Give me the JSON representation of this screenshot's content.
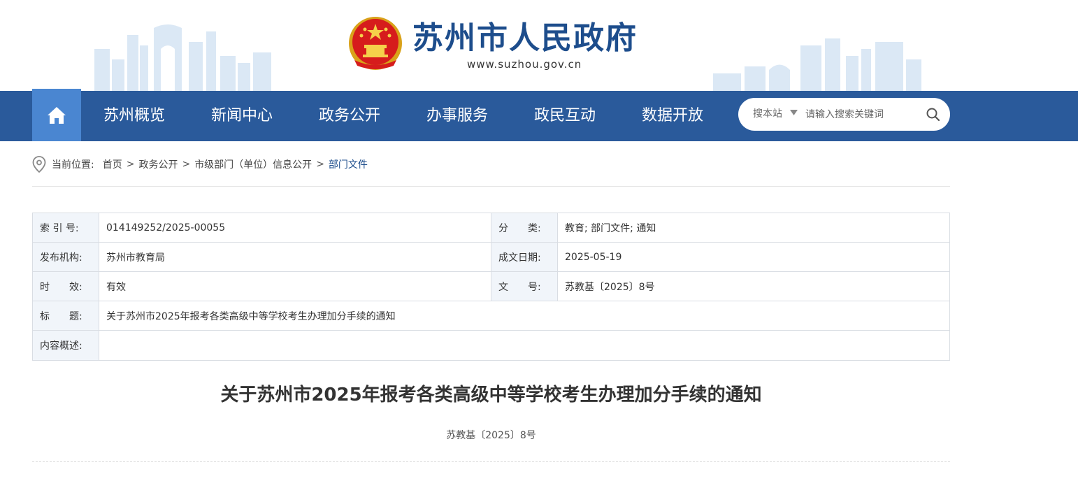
{
  "header": {
    "site_title": "苏州市人民政府",
    "site_url": "www.suzhou.gov.cn"
  },
  "nav": {
    "items": [
      "苏州概览",
      "新闻中心",
      "政务公开",
      "办事服务",
      "政民互动",
      "数据开放"
    ]
  },
  "search": {
    "scope": "搜本站",
    "placeholder": "请输入搜索关键词"
  },
  "breadcrumb": {
    "label": "当前位置:",
    "items": [
      "首页",
      "政务公开",
      "市级部门（单位）信息公开",
      "部门文件"
    ],
    "separator": ">"
  },
  "info_table": {
    "index_label": "索 引 号:",
    "index_value": "014149252/2025-00055",
    "category_label": "分　　类:",
    "category_value": "教育;  部门文件;  通知",
    "publisher_label": "发布机构:",
    "publisher_value": "苏州市教育局",
    "date_label": "成文日期:",
    "date_value": "2025-05-19",
    "validity_label": "时　　效:",
    "validity_value": "有效",
    "docno_label": "文　　号:",
    "docno_value": "苏教基〔2025〕8号",
    "title_label": "标　　题:",
    "title_value": "关于苏州市2025年报考各类高级中等学校考生办理加分手续的通知",
    "summary_label": "内容概述:",
    "summary_value": ""
  },
  "article": {
    "title": "关于苏州市2025年报考各类高级中等学校考生办理加分手续的通知",
    "doc_number": "苏教基〔2025〕8号"
  },
  "colors": {
    "nav_bg": "#2a5a9b",
    "nav_home_bg": "#4a86d1",
    "title_blue": "#1d4d8c",
    "table_label_bg": "#f1f5fa"
  }
}
